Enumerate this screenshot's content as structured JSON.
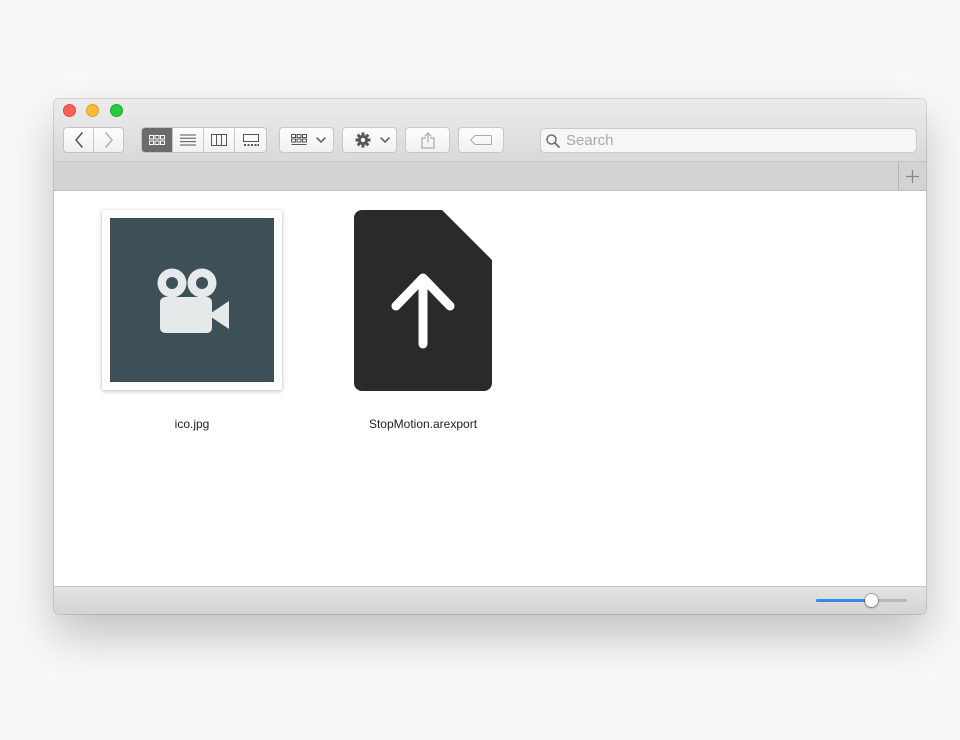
{
  "toolbar": {
    "view_mode_selected": "icon",
    "search": {
      "placeholder": "Search",
      "value": ""
    }
  },
  "files": [
    {
      "name": "ico.jpg",
      "kind": "image-thumbnail",
      "icon": "video-camera-icon",
      "thumb_color": "#3e5057"
    },
    {
      "name": "StopMotion.arexport",
      "kind": "document",
      "icon": "upload-arrow-icon",
      "doc_color": "#2a2a2a"
    }
  ],
  "status_bar": {
    "icon_size_slider": {
      "value": 0.6
    }
  },
  "colors": {
    "accent": "#3b87f4",
    "close": "#fc5f57",
    "minimize": "#fdbc2e",
    "maximize": "#28c840"
  }
}
